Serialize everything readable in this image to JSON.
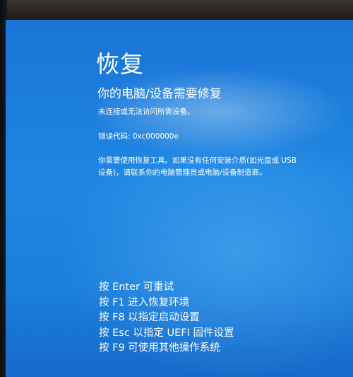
{
  "recovery": {
    "title": "恢复",
    "subtitle": "你的电脑/设备需要修复",
    "message": "未连接或无法访问所需设备。",
    "error_code": "错误代码: 0xc000000e",
    "instructions_line1": "你需要使用恢复工具。如果没有任何安装介质(如光盘或 USB",
    "instructions_line2": "设备)，请联系你的电脑管理员或电脑/设备制造商。"
  },
  "options": [
    {
      "label": "按 Enter 可重试"
    },
    {
      "label": "按 F1 进入恢复环境"
    },
    {
      "label": "按 F8 以指定启动设置"
    },
    {
      "label": "按 Esc 以指定 UEFI 固件设置"
    },
    {
      "label": "按 F9 可使用其他操作系统"
    }
  ],
  "colors": {
    "screen_background": "#1e86e2",
    "text": "#ffffff"
  }
}
